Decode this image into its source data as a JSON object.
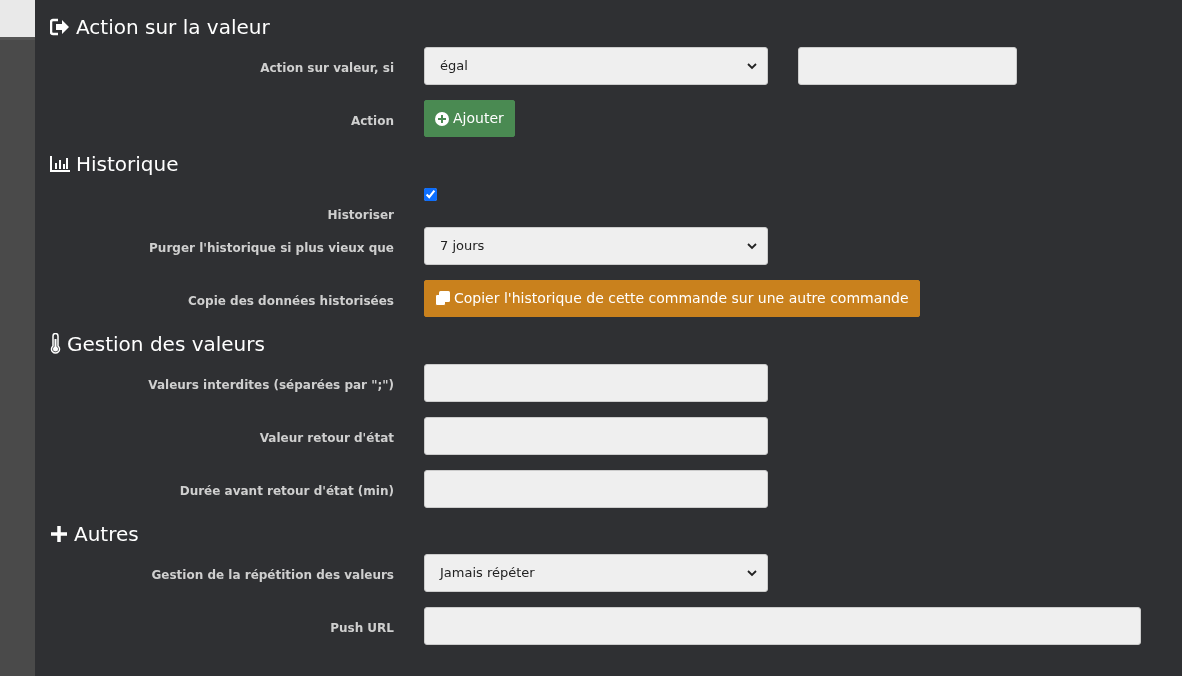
{
  "sections": [
    {
      "title": "Action sur la valeur",
      "rows": [
        {
          "kind": "select_input",
          "label": "Action sur valeur, si",
          "value": "égal"
        },
        {
          "kind": "add_button",
          "label": "Action",
          "button": "Ajouter",
          "color": "#4a8a52"
        }
      ]
    },
    {
      "title": "Historique",
      "rows": [
        {
          "kind": "checkbox",
          "label": "Historiser",
          "checked": true
        },
        {
          "kind": "select",
          "label": "Purger l'historique si plus vieux que",
          "value": "7 jours"
        },
        {
          "kind": "copy_button",
          "label": "Copie des données historisées",
          "button": "Copier l'historique de cette commande sur une autre commande",
          "color": "#c9811d"
        }
      ]
    },
    {
      "title": "Gestion des valeurs",
      "rows": [
        {
          "kind": "input",
          "label": "Valeurs interdites (séparées par \";\")"
        },
        {
          "kind": "input",
          "label": "Valeur retour d'état"
        },
        {
          "kind": "input",
          "label": "Durée avant retour d'état (min)"
        }
      ]
    },
    {
      "title": "Autres",
      "rows": [
        {
          "kind": "select",
          "label": "Gestion de la répétition des valeurs",
          "value": "Jamais répéter"
        },
        {
          "kind": "wide_input",
          "label": "Push URL"
        }
      ]
    }
  ]
}
